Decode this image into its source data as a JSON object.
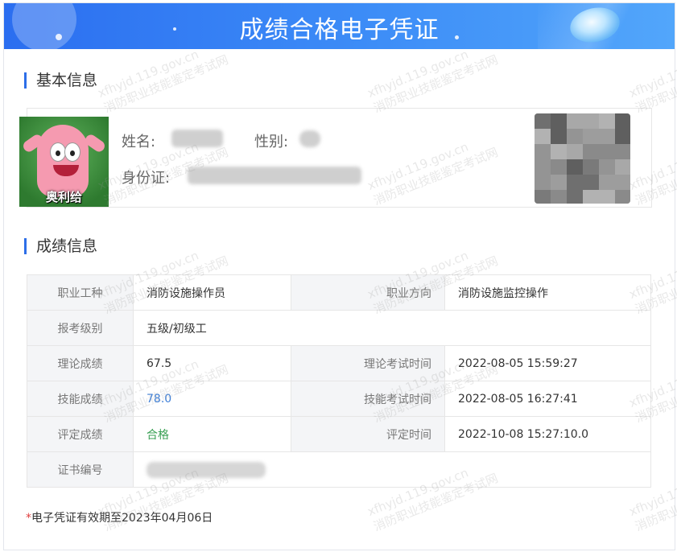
{
  "header": {
    "title": "成绩合格电子凭证"
  },
  "basic": {
    "section_title": "基本信息",
    "avatar_caption": "奥利给",
    "name_label": "姓名:",
    "gender_label": "性别:",
    "id_label": "身份证:"
  },
  "scores": {
    "section_title": "成绩信息",
    "rows": [
      {
        "label1": "职业工种",
        "value1": "消防设施操作员",
        "label2": "职业方向",
        "value2": "消防设施监控操作"
      },
      {
        "label1": "报考级别",
        "value1": "五级/初级工"
      },
      {
        "label1": "理论成绩",
        "value1": "67.5",
        "label2": "理论考试时间",
        "value2": "2022-08-05 15:59:27"
      },
      {
        "label1": "技能成绩",
        "value1": "78.0",
        "label2": "技能考试时间",
        "value2": "2022-08-05 16:27:41"
      },
      {
        "label1": "评定成绩",
        "value1": "合格",
        "label2": "评定时间",
        "value2": "2022-10-08 15:27:10.0"
      },
      {
        "label1": "证书编号"
      }
    ]
  },
  "footer": {
    "star": "*",
    "note": "电子凭证有效期至2023年04月06日"
  },
  "watermark": {
    "domain": "xfhyjd.119.gov.cn",
    "text": "消防职业技能鉴定考试网"
  },
  "colors": {
    "banner": "#3d8df7",
    "accent": "#2d6ee8",
    "skill_score": "#3e7fd8",
    "pass": "#3aa055",
    "star": "#e03e3e"
  }
}
